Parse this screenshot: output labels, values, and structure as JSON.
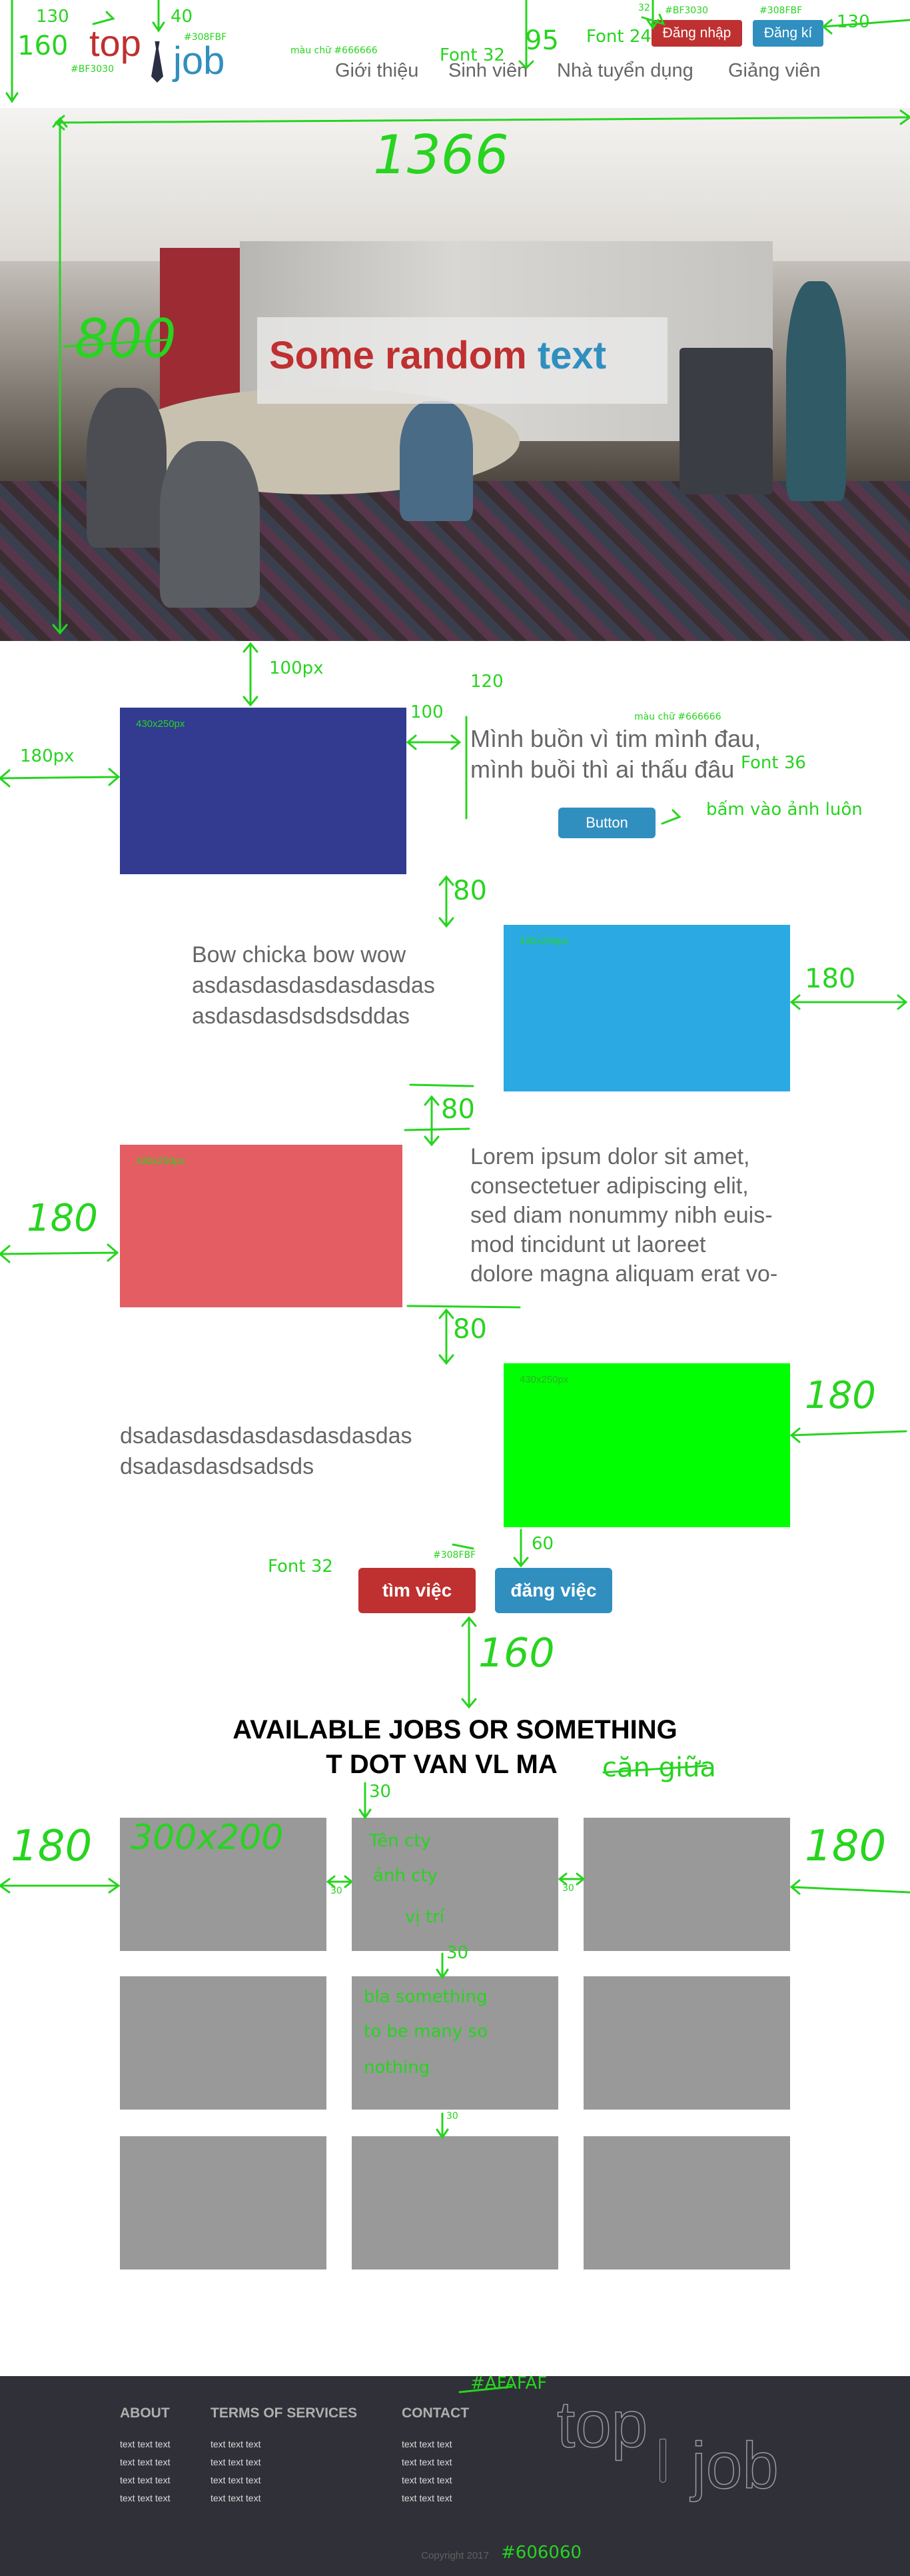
{
  "header": {
    "logo_top": "top",
    "logo_job": "job",
    "nav": [
      "Giới thiệu",
      "Sinh viên",
      "Nhà tuyển dụng",
      "Giảng viên"
    ],
    "login_label": "Đăng nhập",
    "register_label": "Đăng kí"
  },
  "hero": {
    "text_red": "Some random ",
    "text_blue": "text"
  },
  "row1": {
    "placeholder": "430x250px",
    "text_line1": "Mình buồn vì tim mình đau,",
    "text_line2": "mình buồi thì ai thấu đâu",
    "button": "Button"
  },
  "row2": {
    "placeholder": "430x250px",
    "text_lines": [
      "Bow chicka bow wow",
      "asdasdasdasdasdasdas",
      "asdasdasdsdsdsddas"
    ]
  },
  "row3": {
    "placeholder": "430x250px",
    "text_lines": [
      "Lorem ipsum dolor sit amet,",
      "consectetuer adipiscing elit,",
      "sed diam nonummy nibh euis-",
      "mod tincidunt ut laoreet",
      "dolore magna aliquam erat vo-"
    ]
  },
  "row4": {
    "placeholder": "430x250px",
    "text_lines": [
      "dsadasdasdasdasdasdasdas",
      "dsadasdasdsadsds"
    ]
  },
  "cta": {
    "find_job": "tìm việc",
    "post_job": "đăng việc"
  },
  "jobs": {
    "title_line1": "AVAILABLE JOBS OR SOMETHING",
    "title_line2": "T DOT VAN VL MA"
  },
  "footer": {
    "about": "ABOUT",
    "terms": "TERMS OF SERVICES",
    "contact": "CONTACT",
    "link_text": "text text text",
    "logo_top": "top",
    "logo_job": "job",
    "copyright": "Copyright 2017"
  },
  "annotations": {
    "a130": "130",
    "a160": "160",
    "a40": "40",
    "bg_308fbf": "#308FBF",
    "bg_bf3030": "#BF3030",
    "mau_chu": "màu chữ #666666",
    "font32": "Font 32",
    "a95": "95",
    "font24": "Font 24",
    "a32": "32",
    "hdr_bf": "#BF3030",
    "hdr_308": "#308FBF",
    "hdr_130": "130",
    "w1366": "1366",
    "h800": "800",
    "a100px": "100px",
    "a100": "100",
    "a120": "120",
    "a180px": "180px",
    "mau_chu2": "màu chữ #666666",
    "font36": "Font 36",
    "btn_note": "bấm vào ảnh luôn",
    "a80_1": "80",
    "a180_1": "180",
    "a80_2": "80",
    "a180_2": "180",
    "a80_3": "80",
    "a180_3": "180",
    "a60": "60",
    "font32b": "Font 32",
    "cta_308": "#308FBF",
    "a160b": "160",
    "can_giua": "căn giữa",
    "job_size": "300x200",
    "a30": "30",
    "a180_l": "180",
    "a180_r": "180",
    "gap30_l": "30",
    "gap30_r": "30",
    "job_note1": "Tên cty",
    "job_note2": "ảnh cty",
    "job_note3": "vị trí",
    "job_note4": "bla something",
    "job_note5": "to be many so",
    "job_note6": "nothing",
    "gap30_v1": "30",
    "gap30_v2": "30",
    "afafaf": "#AFAFAF",
    "c606060": "#606060"
  }
}
